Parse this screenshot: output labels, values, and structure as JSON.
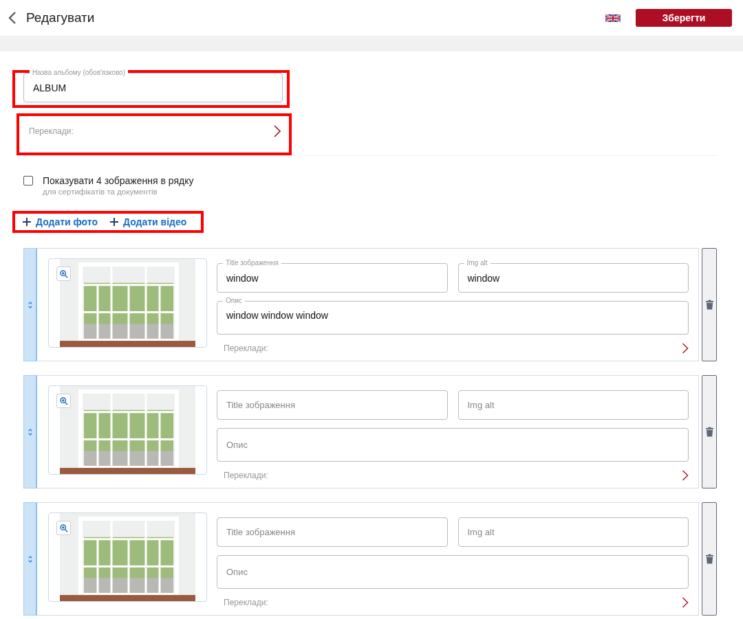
{
  "header": {
    "title": "Редагувати",
    "save_button": "Зберегти"
  },
  "album_name": {
    "label": "Назва альбому (обов'язково)",
    "value": "ALBUM",
    "highlighted": true
  },
  "translations": {
    "label": "Переклади:",
    "highlighted": true
  },
  "four_per_row": {
    "label": "Показувати 4 зображення в рядку",
    "hint": "для сертифікатів та документів",
    "checked": false
  },
  "add_buttons": {
    "highlighted": true,
    "items": [
      "Додати фото",
      "Додати відео"
    ]
  },
  "media": [
    {
      "title": {
        "label": "Title зображення",
        "value": "window"
      },
      "alt": {
        "label": "Img alt",
        "value": "window"
      },
      "description": {
        "label": "Опис",
        "value": "window window window"
      },
      "translations": "Переклади:"
    },
    {
      "title": {
        "placeholder": "Title зображення"
      },
      "alt": {
        "placeholder": "Img alt"
      },
      "description": {
        "placeholder": "Опис"
      },
      "translations": "Переклади:"
    },
    {
      "title": {
        "placeholder": "Title зображення"
      },
      "alt": {
        "placeholder": "Img alt"
      },
      "description": {
        "placeholder": "Опис"
      },
      "translations": "Переклади:"
    }
  ]
}
